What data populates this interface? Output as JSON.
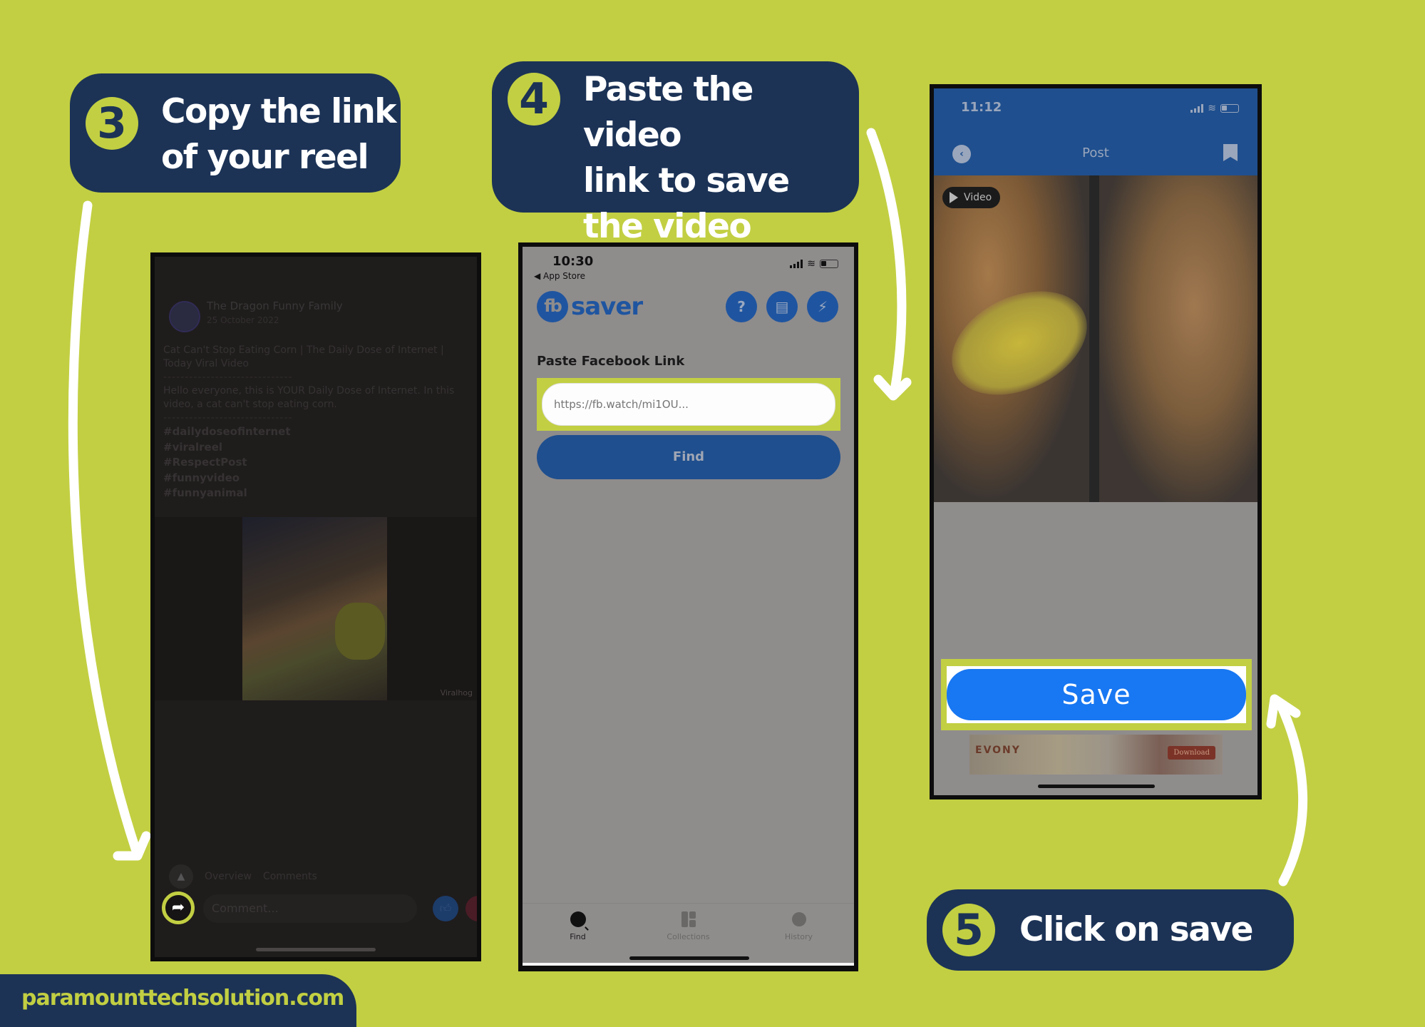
{
  "colors": {
    "background": "#c2cf42",
    "callout_bg": "#1c3356",
    "accent": "#c2cf42",
    "save_blue": "#1877f2",
    "fbsaver_blue": "#1f55a0"
  },
  "steps": [
    {
      "number": "3",
      "text": "Copy the link\nof your reel"
    },
    {
      "number": "4",
      "text": "Paste the video\nlink to  save\nthe video"
    },
    {
      "number": "5",
      "text": "Click on save"
    }
  ],
  "phone1": {
    "page_name": "The Dragon Funny Family",
    "post_date": "25 October 2022",
    "title": "Cat Can't Stop Eating Corn | The Daily Dose of Internet | Today Viral Video",
    "separator": "------------------------------",
    "description": "Hello everyone, this is YOUR Daily Dose of Internet. In this video, a cat can't stop eating corn.",
    "hashtags": [
      "#dailydoseofinternet",
      "#viralreel",
      "#RespectPost",
      "#funnyvideo",
      "#funnyanimal"
    ],
    "watermark": "Viralhog",
    "tabs": [
      "Overview",
      "Comments"
    ],
    "comment_placeholder": "Comment...",
    "icons": {
      "share": "share-arrow-icon",
      "like": "thumbs-up-icon",
      "love": "heart-icon",
      "collapse": "chevron-up-icon"
    }
  },
  "phone2": {
    "status_time": "10:30",
    "back_to": "◀ App Store",
    "logo_badge": "fb",
    "logo_text": "saver",
    "header_icons": [
      "help-icon",
      "inbox-icon",
      "flash-icon"
    ],
    "paste_label": "Paste Facebook Link",
    "link_placeholder": "https://fb.watch/mi1OU...",
    "find_label": "Find",
    "tabs": [
      {
        "label": "Find",
        "icon": "search-icon",
        "active": true
      },
      {
        "label": "Collections",
        "icon": "collections-icon",
        "active": false
      },
      {
        "label": "History",
        "icon": "stopwatch-icon",
        "active": false
      }
    ]
  },
  "phone3": {
    "status_time": "11:12",
    "title": "Post",
    "video_badge": "Video",
    "save_label": "Save",
    "ad": {
      "brand": "EVONY",
      "cta": "Download"
    }
  },
  "footer": {
    "website": "paramounttechsolution.com"
  }
}
